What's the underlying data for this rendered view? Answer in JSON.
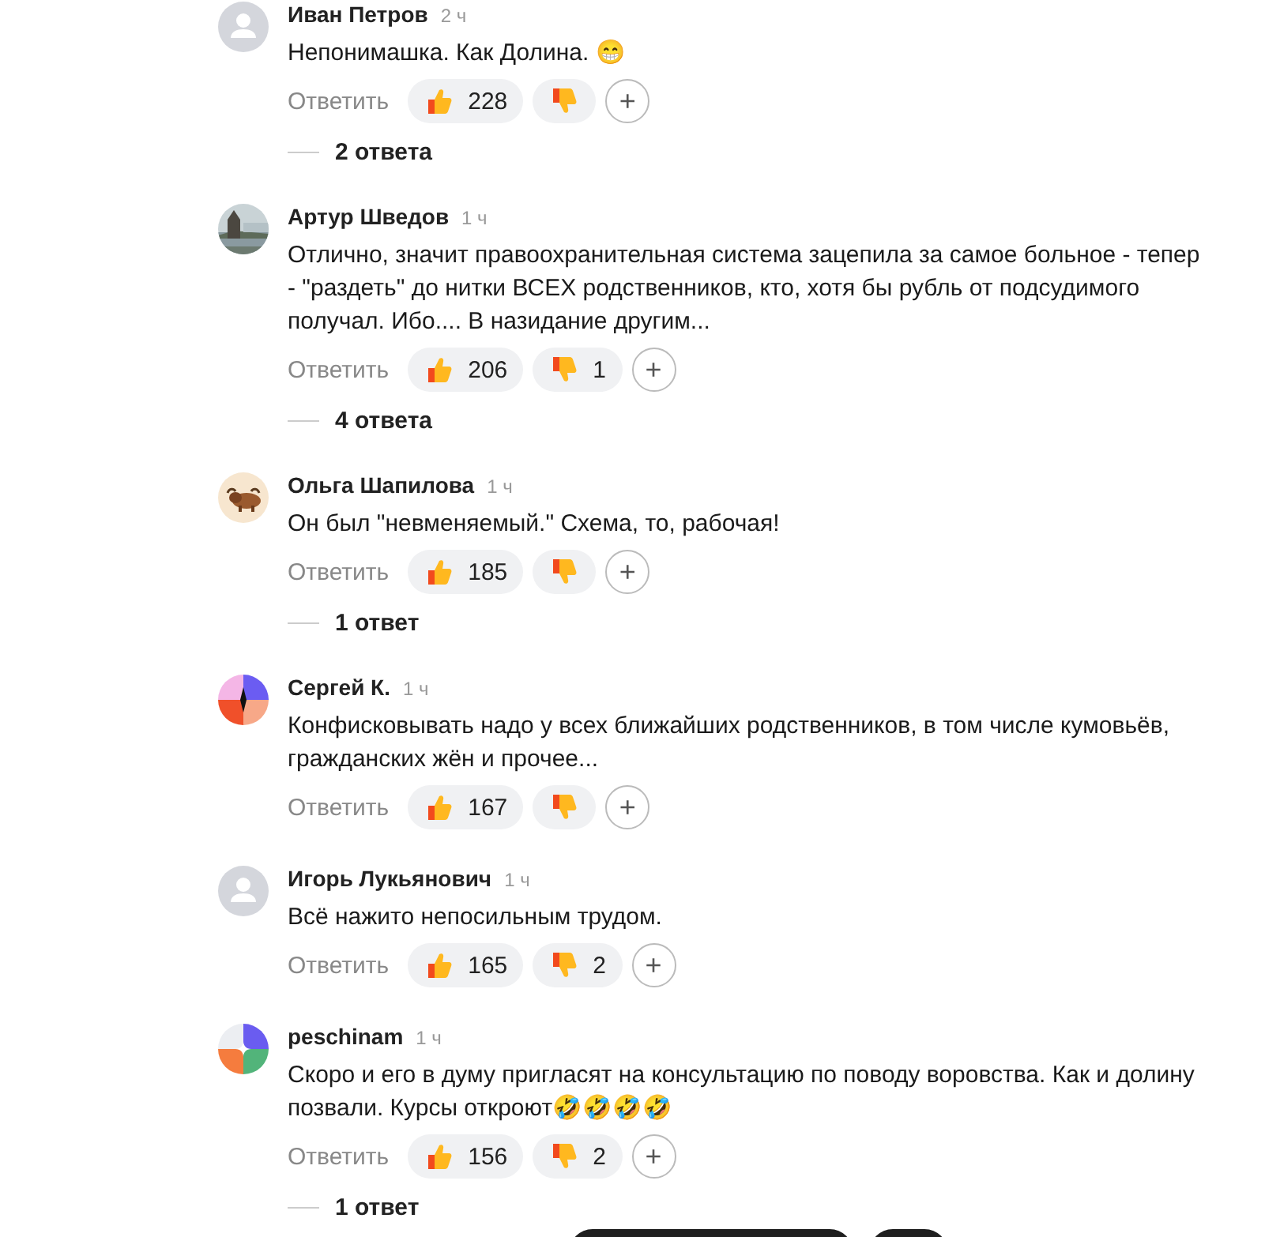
{
  "comments": [
    {
      "author": "Иван Петров",
      "time": "2 ч",
      "avatar": {
        "kind": "silhouette"
      },
      "text": "Непонимашка. Как Долина. 😁",
      "reply": "Ответить",
      "likes": "228",
      "more": "+",
      "replies": "2 ответа"
    },
    {
      "author": "Артур Шведов",
      "time": "1 ч",
      "text": "Отлично, значит правоохранительная система зацепила за самое больное - тепер\n- \"раздеть\" до нитки ВСЕХ родственников, кто, хотя бы рубль от подсудимого\nполучал. Ибо.... В назидание другим...",
      "reply": "Ответить",
      "likes": "206",
      "dislikes": "1",
      "more": "+",
      "replies": "4 ответа"
    },
    {
      "author": "Ольга Шапилова",
      "time": "1 ч",
      "avatar": {
        "kind": "animal"
      },
      "text": "Он был \"невменяемый.\" Схема, то, рабочая!",
      "reply": "Ответить",
      "likes": "185",
      "more": "+",
      "replies": "1 ответ"
    },
    {
      "author": "Сергей К.",
      "time": "1 ч",
      "avatar": {
        "kind": "shapes"
      },
      "text": "Конфисковывать надо у всех ближайших родственников, в том числе кумовьёв,\nгражданских жён и прочее...",
      "reply": "Ответить",
      "likes": "167",
      "more": "+"
    },
    {
      "author": "Игорь Лукьянович",
      "time": "1 ч",
      "avatar": {
        "kind": "silhouette"
      },
      "text": "Всё нажито непосильным трудом.",
      "reply": "Ответить",
      "likes": "165",
      "dislikes": "2",
      "more": "+"
    },
    {
      "author": "peschinam",
      "time": "1 ч",
      "avatar": {
        "kind": "quadrants"
      },
      "text": "Скоро и его в думу пригласят на консультацию по поводу воровства. Как и долину\nпозвали. Курсы откроют🤣🤣🤣🤣",
      "reply": "Ответить",
      "likes": "156",
      "dislikes": "2",
      "more": "+",
      "replies": "1 ответ"
    }
  ]
}
